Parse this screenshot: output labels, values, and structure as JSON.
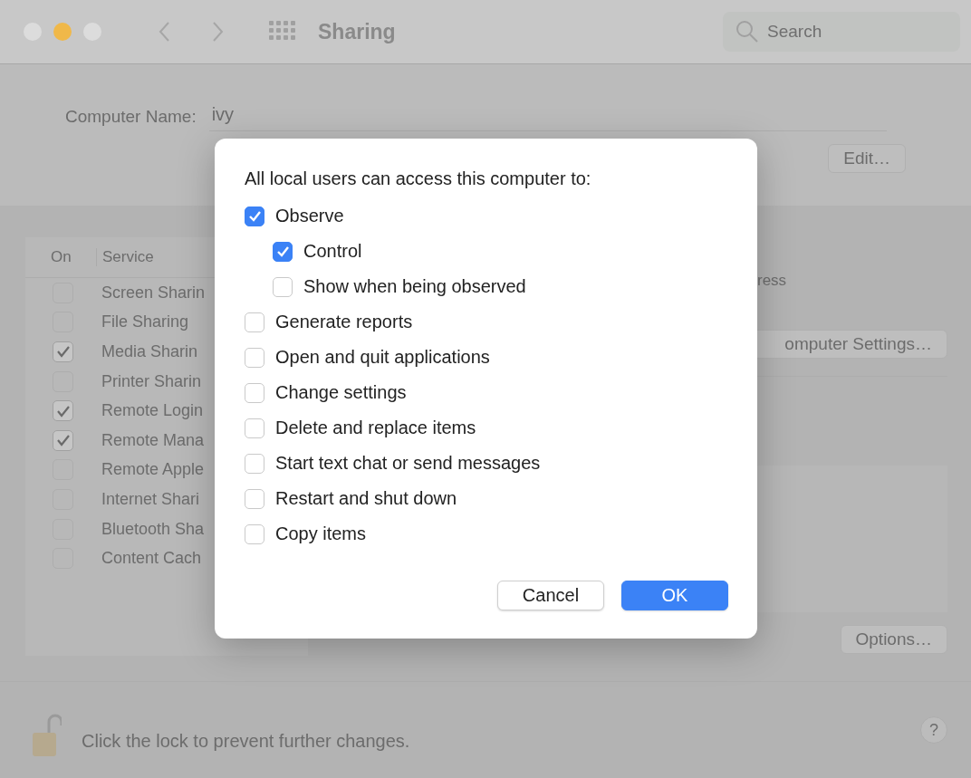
{
  "window": {
    "title": "Sharing",
    "search": {
      "placeholder": "Search"
    }
  },
  "computer_name": {
    "label": "Computer Name:",
    "value": "ivy",
    "edit_button": "Edit…"
  },
  "services": {
    "columns": [
      "On",
      "Service"
    ],
    "rows": [
      {
        "name": "Screen Sharin",
        "on": false
      },
      {
        "name": "File Sharing",
        "on": false
      },
      {
        "name": "Media Sharin",
        "on": true
      },
      {
        "name": "Printer Sharin",
        "on": false
      },
      {
        "name": "Remote Login",
        "on": true
      },
      {
        "name": "Remote Mana",
        "on": true
      },
      {
        "name": "Remote Apple",
        "on": false
      },
      {
        "name": "Internet Shari",
        "on": false
      },
      {
        "name": "Bluetooth Sha",
        "on": false
      },
      {
        "name": "Content Cach",
        "on": false
      }
    ]
  },
  "details": {
    "address_label": "ress",
    "computer_settings_button": "omputer Settings…",
    "options_button": "Options…"
  },
  "footer": {
    "lock_text": "Click the lock to prevent further changes.",
    "help_button": "?"
  },
  "dialog": {
    "heading": "All local users can access this computer to:",
    "options": [
      {
        "label": "Observe",
        "checked": true,
        "children": [
          {
            "label": "Control",
            "checked": true
          },
          {
            "label": "Show when being observed",
            "checked": false
          }
        ]
      },
      {
        "label": "Generate reports",
        "checked": false
      },
      {
        "label": "Open and quit applications",
        "checked": false
      },
      {
        "label": "Change settings",
        "checked": false
      },
      {
        "label": "Delete and replace items",
        "checked": false
      },
      {
        "label": "Start text chat or send messages",
        "checked": false
      },
      {
        "label": "Restart and shut down",
        "checked": false
      },
      {
        "label": "Copy items",
        "checked": false
      }
    ],
    "buttons": [
      {
        "label": "Cancel",
        "kind": "secondary"
      },
      {
        "label": "OK",
        "kind": "primary"
      }
    ]
  }
}
